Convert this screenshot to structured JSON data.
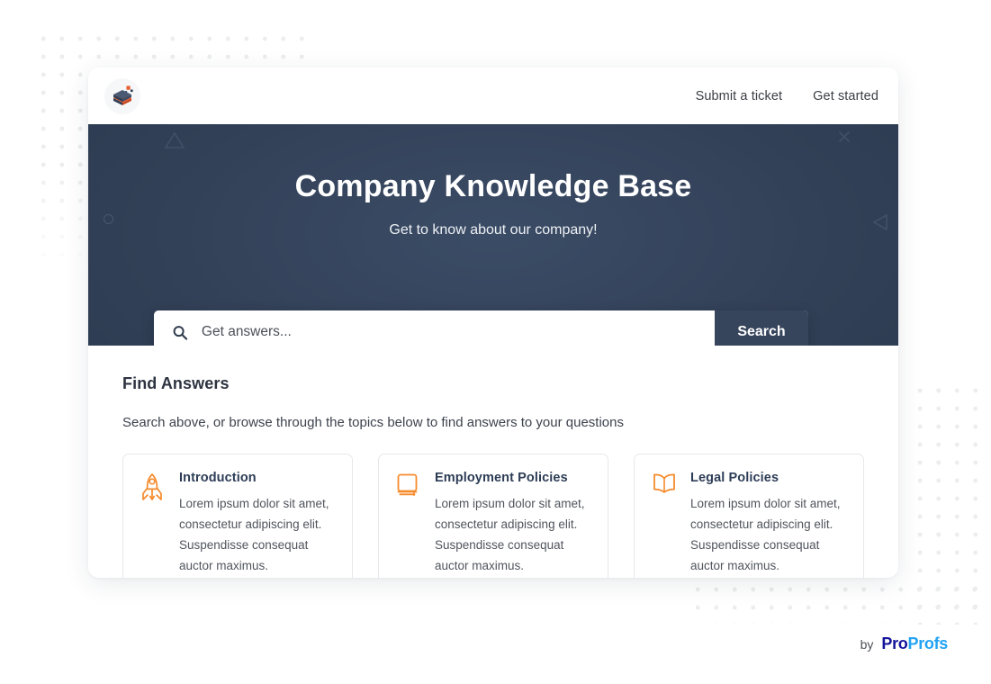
{
  "header": {
    "logo_name": "knowledge-base-logo",
    "nav": [
      {
        "label": "Submit a ticket",
        "name": "submit-a-ticket"
      },
      {
        "label": "Get started",
        "name": "get-started"
      }
    ]
  },
  "hero": {
    "title": "Company Knowledge Base",
    "subtitle": "Get to know about our company!",
    "background_color": "#334158",
    "search": {
      "placeholder": "Get answers...",
      "value": "",
      "button_label": "Search",
      "button_color": "#37455c",
      "icon": "search-icon"
    }
  },
  "main": {
    "heading": "Find Answers",
    "subheading": "Search above, or browse through the topics below to find answers to your questions",
    "accent_color": "#f68b2c",
    "categories": [
      {
        "icon": "rocket-icon",
        "title": "Introduction",
        "description": "Lorem ipsum dolor sit amet, consectetur adipiscing elit. Suspendisse consequat auctor maximus."
      },
      {
        "icon": "closed-book-icon",
        "title": "Employment Policies",
        "description": "Lorem ipsum dolor sit amet, consectetur adipiscing elit. Suspendisse consequat auctor maximus."
      },
      {
        "icon": "open-book-icon",
        "title": "Legal Policies",
        "description": "Lorem ipsum dolor sit amet, consectetur adipiscing elit. Suspendisse consequat auctor maximus."
      }
    ]
  },
  "footer": {
    "by_label": "by",
    "brand_first": "Pro",
    "brand_second": "Profs",
    "brand_first_color": "#14149b",
    "brand_second_color": "#22a3f2"
  }
}
